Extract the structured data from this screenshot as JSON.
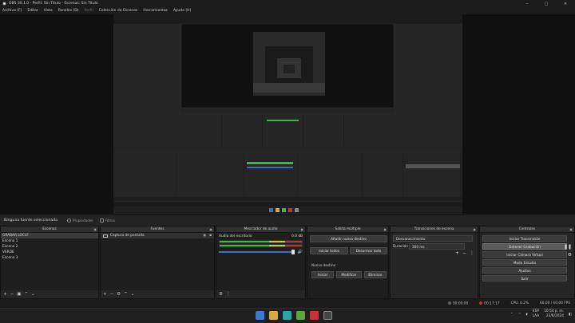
{
  "window": {
    "title": "OBS 30.1.0 - Perfil: Sin Título - Escenas: Sin Título",
    "controls": [
      "─",
      "□",
      "✕"
    ]
  },
  "menu": {
    "items": [
      "Archivo (F)",
      "Editar",
      "Vista",
      "Paneles (D)",
      "Perfil",
      "Colección de Escenas",
      "Herramientas",
      "Ayuda (H)"
    ]
  },
  "source_bar": {
    "no_source": "Ninguna fuente seleccionada",
    "properties": "Propiedades",
    "filters": "Filtros"
  },
  "scenes": {
    "title": "Escenas",
    "items": [
      "GRABAR LOCLF",
      "Escena 1",
      "Escena 2",
      "VERDE",
      "Escena 3"
    ],
    "selected": 0
  },
  "sources": {
    "title": "Fuentes",
    "items": [
      "Captura de pantalla"
    ]
  },
  "mixer": {
    "title": "Mezclador de audio",
    "channel": "Audio del escritorio",
    "level": "0.0 dB",
    "volume": 1.0
  },
  "studio": {
    "title": "Salida múltiple",
    "add_dest": "Añadir nuevo destino",
    "start_all": "Iniciar todos",
    "stop_all": "Desarmar todo",
    "new_dest": "Nuevo destino",
    "start": "Iniciar",
    "modify": "Modificar",
    "delete": "Eliminar"
  },
  "transitions": {
    "title": "Transiciones de escena",
    "selected": "Desvanecimiento",
    "duration_label": "Duración",
    "duration": "300 ms"
  },
  "controls": {
    "title": "Controles",
    "buttons": [
      "Iniciar Transmisión",
      "Detener Grabación",
      "Iniciar Cámara Virtual",
      "Modo Estudio",
      "Ajustes",
      "Salir"
    ],
    "active_index": 1
  },
  "status": {
    "live": "00:00:00",
    "rec": "00:17:17",
    "cpu": "CPU: 0.2%",
    "fps": "60.00 / 60.00 FPS"
  },
  "taskbar": {
    "lang_top": "ESP",
    "lang_bottom": "LAA",
    "time": "10:54 p. m.",
    "date": "23/6/2024"
  },
  "colors": {
    "accent_blue": "#3a6fc4",
    "record_red": "#c83232",
    "meter_green": "#3fb43f"
  }
}
